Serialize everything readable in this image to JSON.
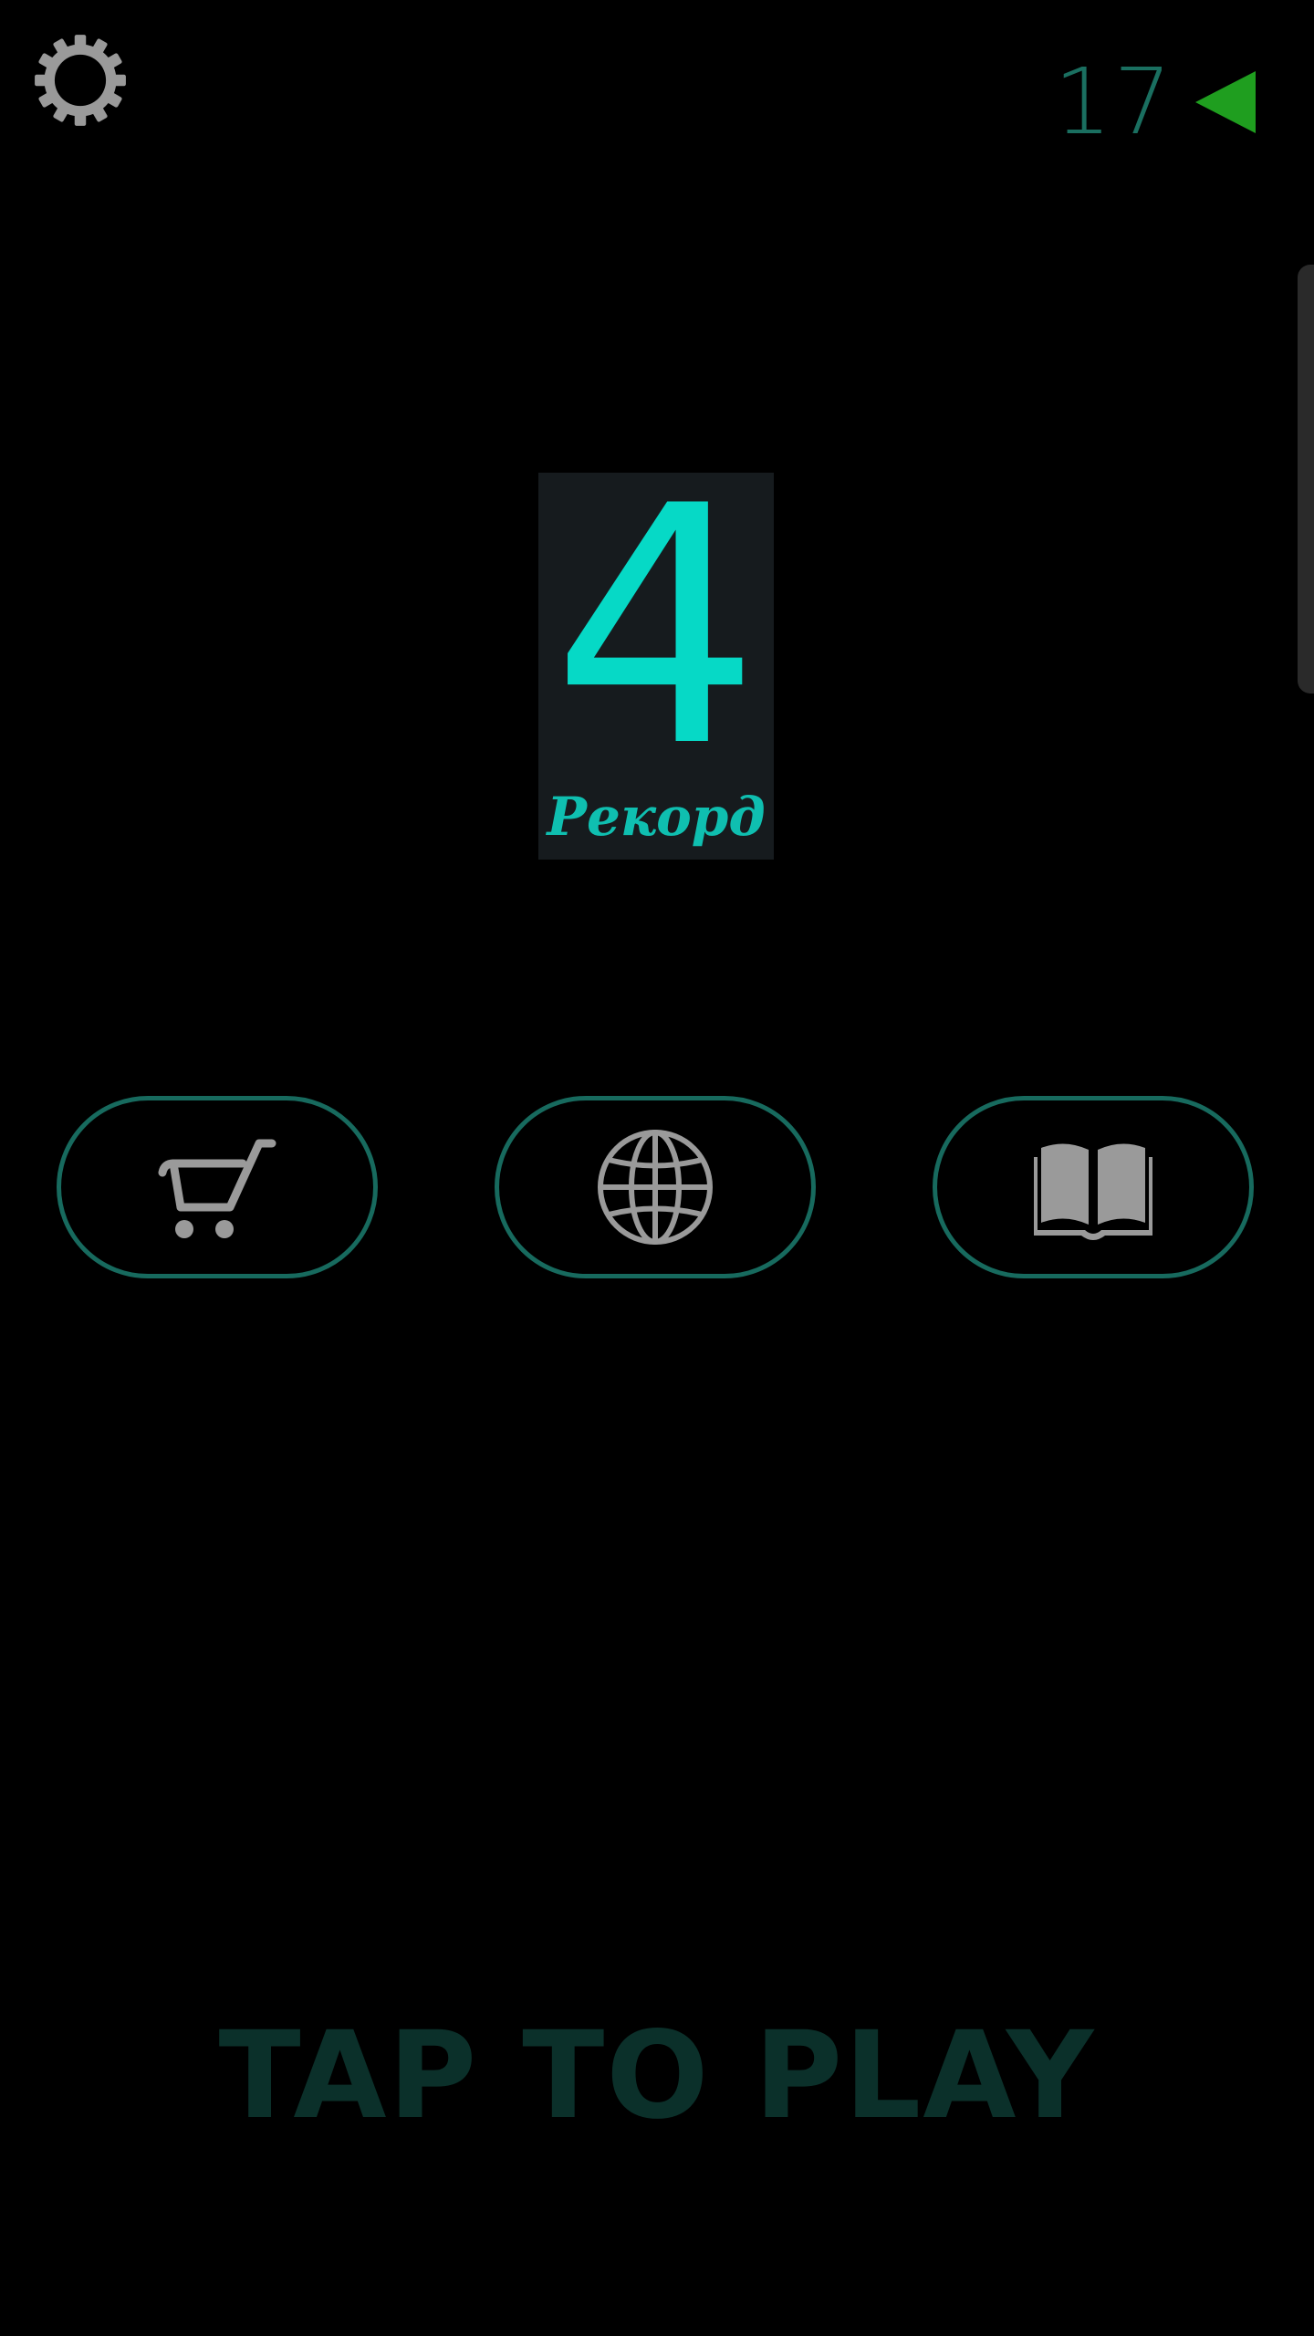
{
  "top_bar": {
    "settings_icon": "gear-icon",
    "counter_value": "17",
    "counter_icon": "play-arrow-left-icon"
  },
  "record": {
    "score": "4",
    "label": "Рекорд"
  },
  "menu": {
    "buttons": [
      {
        "icon": "shopping-cart-icon"
      },
      {
        "icon": "globe-icon"
      },
      {
        "icon": "book-icon"
      }
    ]
  },
  "footer": {
    "tap_to_play": "TAP TO PLAY"
  },
  "colors": {
    "background": "#000000",
    "accent_cyan": "#06d9c6",
    "button_border": "#176a5e",
    "counter_text": "#1a6f60",
    "arrow_green": "#1f9e1f",
    "icon_gray": "#9a9a9a",
    "tap_text": "#0b302a",
    "card_bg": "#161b1e"
  }
}
